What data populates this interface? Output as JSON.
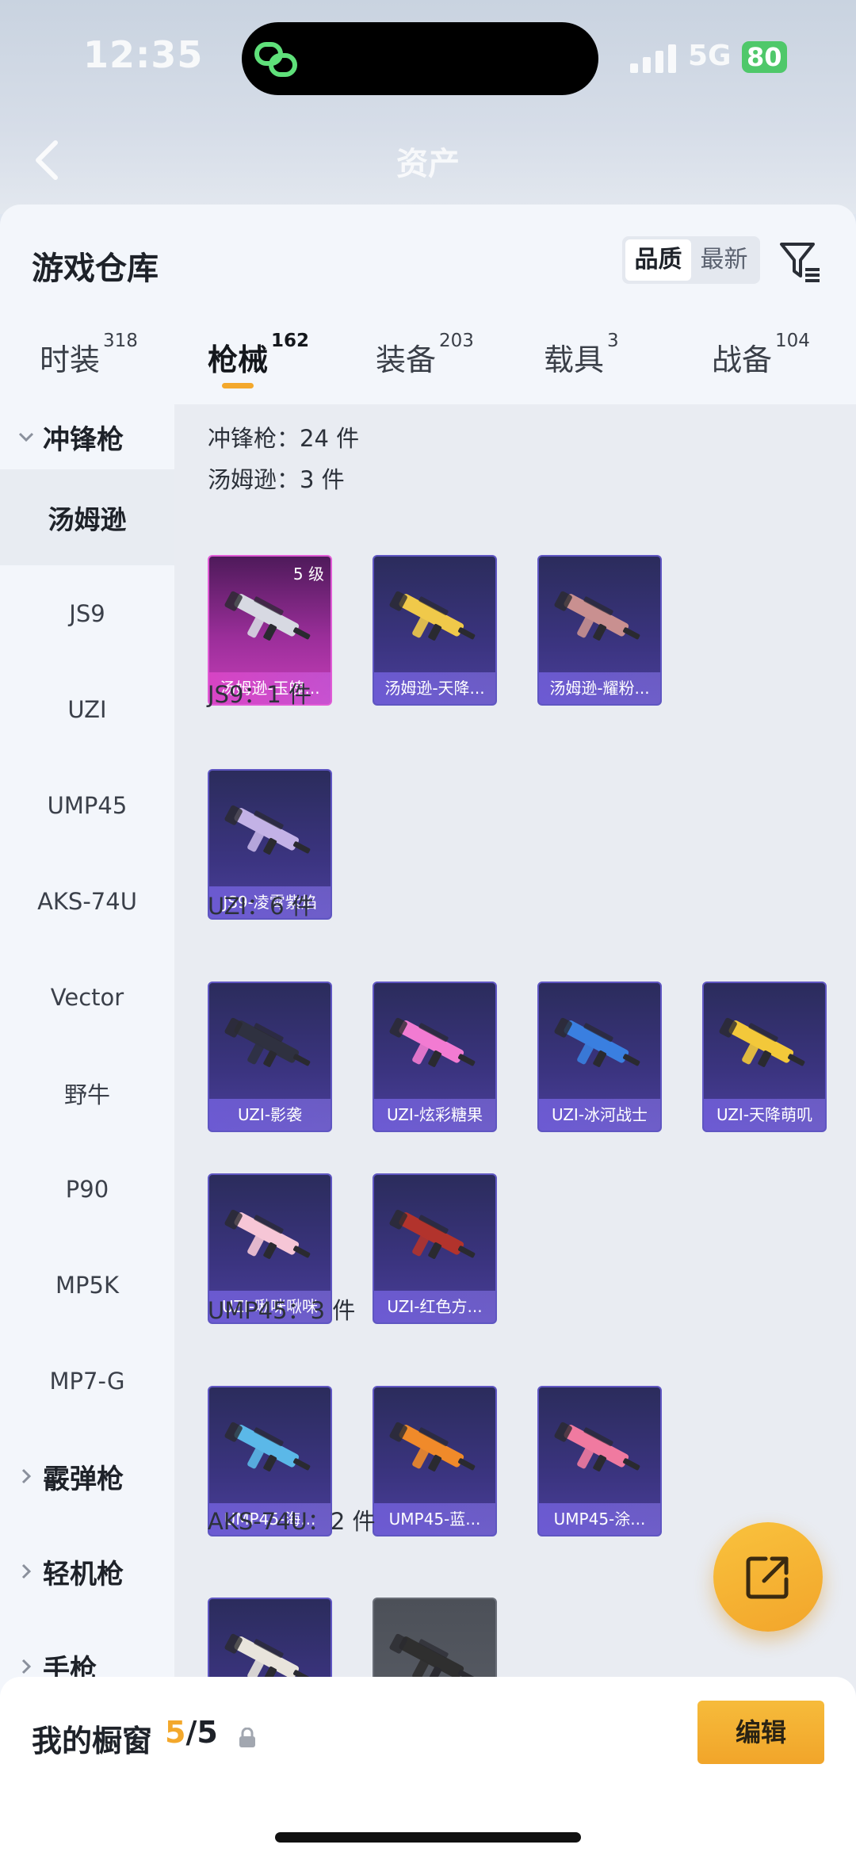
{
  "status_bar": {
    "time": "12:35",
    "network": "5G",
    "battery": "80"
  },
  "header": {
    "title": "资产"
  },
  "panel": {
    "title": "游戏仓库",
    "sort_options": [
      "品质",
      "最新"
    ]
  },
  "tabs": [
    {
      "label": "时装",
      "count": "318"
    },
    {
      "label": "枪械",
      "count": "162"
    },
    {
      "label": "装备",
      "count": "203"
    },
    {
      "label": "载具",
      "count": "3"
    },
    {
      "label": "战备",
      "count": "104"
    }
  ],
  "sidebar": {
    "group_open": "冲锋枪",
    "items": [
      "汤姆逊",
      "JS9",
      "UZI",
      "UMP45",
      "AKS-74U",
      "Vector",
      "野牛",
      "P90",
      "MP5K",
      "MP7-G"
    ],
    "groups_closed": [
      "霰弹枪",
      "轻机枪",
      "手枪"
    ]
  },
  "content": {
    "total": "冲锋枪：24 件",
    "sections": [
      {
        "title": "汤姆逊：3 件",
        "items": [
          {
            "name": "汤姆逊-玉魄...",
            "level": "5 级",
            "rarity": "pink"
          },
          {
            "name": "汤姆逊-天降...",
            "rarity": "purple"
          },
          {
            "name": "汤姆逊-耀粉...",
            "rarity": "purple"
          }
        ]
      },
      {
        "title": "JS9：1 件",
        "items": [
          {
            "name": "JS9-凌霄紫焰",
            "rarity": "purple"
          }
        ]
      },
      {
        "title": "UZI：6 件",
        "items": [
          {
            "name": "UZI-影袭",
            "rarity": "purple"
          },
          {
            "name": "UZI-炫彩糖果",
            "rarity": "purple"
          },
          {
            "name": "UZI-冰河战士",
            "rarity": "purple"
          },
          {
            "name": "UZI-天降萌叽",
            "rarity": "purple"
          },
          {
            "name": "UZI-啾咪啾咪",
            "rarity": "purple"
          },
          {
            "name": "UZI-红色方...",
            "rarity": "purple"
          }
        ]
      },
      {
        "title": "UMP45：3 件",
        "items": [
          {
            "name": "UMP45-海...",
            "rarity": "purple"
          },
          {
            "name": "UMP45-蓝...",
            "rarity": "purple"
          },
          {
            "name": "UMP45-涂...",
            "rarity": "purple"
          }
        ]
      },
      {
        "title": "AKS-74U：2 件",
        "items": [
          {
            "name": "",
            "rarity": "purple"
          },
          {
            "name": "",
            "rarity": "gray"
          }
        ]
      }
    ]
  },
  "bottom_bar": {
    "label": "我的橱窗",
    "current": "5",
    "total": "/5",
    "edit_label": "编辑"
  },
  "colors": {
    "accent": "#f3a82c",
    "card_purple": "#3b3480",
    "card_pink": "#c73fb8"
  }
}
